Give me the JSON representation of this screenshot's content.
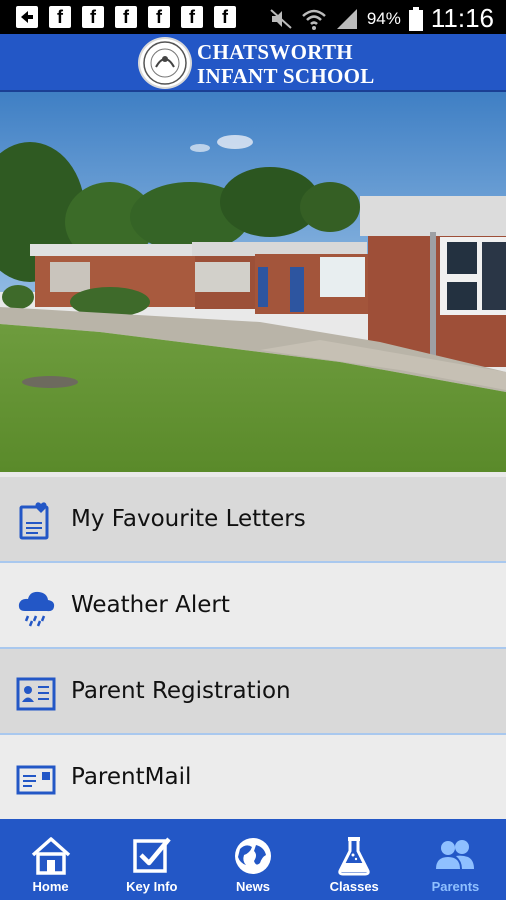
{
  "status_bar": {
    "left_icons": [
      "back-icon",
      "facebook-icon",
      "facebook-icon",
      "facebook-icon",
      "facebook-icon",
      "facebook-icon",
      "facebook-icon"
    ],
    "facebook_glyph": "f",
    "battery_text": "94%",
    "time": "11:16"
  },
  "header": {
    "school_name_line1": "CHATSWORTH",
    "school_name_line2": "INFANT SCHOOL"
  },
  "menu": {
    "items": [
      {
        "label": "My Favourite Letters",
        "icon": "favourite-letters-icon"
      },
      {
        "label": "Weather Alert",
        "icon": "weather-cloud-icon"
      },
      {
        "label": "Parent Registration",
        "icon": "registration-card-icon"
      },
      {
        "label": "ParentMail",
        "icon": "mail-card-icon"
      }
    ]
  },
  "bottom_nav": {
    "items": [
      {
        "label": "Home",
        "icon": "home-icon"
      },
      {
        "label": "Key Info",
        "icon": "checkmark-icon"
      },
      {
        "label": "News",
        "icon": "globe-icon"
      },
      {
        "label": "Classes",
        "icon": "flask-icon"
      },
      {
        "label": "Parents",
        "icon": "parents-icon"
      }
    ],
    "active": "Parents"
  },
  "colors": {
    "primary": "#2357c6",
    "active_tab": "#8fc0ff",
    "menu_alt": "#d9d9d9",
    "menu_plain": "#ececec",
    "menu_divider": "#a9c8ee"
  }
}
